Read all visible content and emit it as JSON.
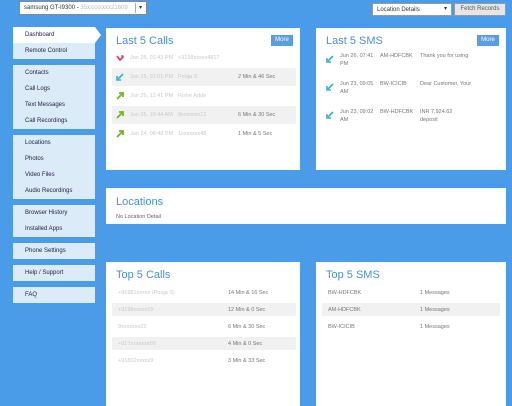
{
  "toolbar": {
    "device_label": "samsung GT-I9300 -",
    "device_id": "35xxxxxxxx21609",
    "location_select": "Location Details",
    "fetch_label": "Fetch Records"
  },
  "sidebar": {
    "groups": [
      [
        {
          "label": "Dashboard",
          "active": true
        },
        {
          "label": "Remote Control"
        }
      ],
      [
        {
          "label": "Contacts"
        },
        {
          "label": "Call Logs"
        },
        {
          "label": "Text Messages"
        },
        {
          "label": "Call Recordings"
        }
      ],
      [
        {
          "label": "Locations"
        },
        {
          "label": "Photos"
        },
        {
          "label": "Video Files"
        },
        {
          "label": "Audio Recordings"
        }
      ],
      [
        {
          "label": "Browser History"
        },
        {
          "label": "Installed Apps"
        }
      ],
      [
        {
          "label": "Phone Settings"
        }
      ],
      [
        {
          "label": "Help / Support"
        }
      ],
      [
        {
          "label": "FAQ"
        }
      ]
    ]
  },
  "last_calls": {
    "title": "Last 5 Calls",
    "more": "More",
    "rows": [
      {
        "type": "missed",
        "time": "Jun 25, 03:43 PM",
        "who": "+9198xxxxx4817",
        "dur": ""
      },
      {
        "type": "incoming",
        "time": "Jun 25, 01:01 PM",
        "who": "Pooja S",
        "dur": "2 Min & 46 Sec"
      },
      {
        "type": "outgoing",
        "time": "Jun 25, 12:41 PM",
        "who": "Rishe Adde",
        "dur": ""
      },
      {
        "type": "outgoing",
        "time": "Jun 25, 10:44 AM",
        "who": "9xxxxxxx12",
        "dur": "6 Min & 30 Sec"
      },
      {
        "type": "outgoing",
        "time": "Jun 24, 08:48 PM",
        "who": "1xxxxxxx48",
        "dur": "1 Min & 5 Sec"
      }
    ]
  },
  "last_sms": {
    "title": "Last 5 SMS",
    "more": "More",
    "rows": [
      {
        "time1": "Jun 26, 07:41",
        "time2": "PM",
        "sender": "AM-HDFCBK",
        "text": "Thank you for using"
      },
      {
        "time1": "Jun 23, 09:05",
        "time2": "AM",
        "sender": "BW-ICICIB",
        "text": "Dear Customer, Your"
      },
      {
        "time1": "Jun 23, 09:02",
        "time2": "AM",
        "sender": "BW-HDFCBK",
        "text": "INR 7,924.62",
        "text2": "deposit"
      }
    ]
  },
  "locations": {
    "title": "Locations",
    "empty": "No Location Detail"
  },
  "top_calls": {
    "title": "Top 5 Calls",
    "rows": [
      {
        "who": "+91981xxxxx (Pooja S)",
        "dur": "14 Min & 16 Sec"
      },
      {
        "who": "+9198xxxxx15",
        "dur": "12 Min & 0 Sec"
      },
      {
        "who": "9xxxxxxx22",
        "dur": "6 Min & 30 Sec"
      },
      {
        "who": "+917xxxxxxx09",
        "dur": "4 Min & 0 Sec"
      },
      {
        "who": "+91802xxxxx9",
        "dur": "3 Min & 33 Sec"
      }
    ]
  },
  "top_sms": {
    "title": "Top 5 SMS",
    "rows": [
      {
        "sender": "BW-HDFCBK",
        "count": "1 Messages"
      },
      {
        "sender": "AM-HDFCBK",
        "count": "1 Messages"
      },
      {
        "sender": "BW-ICICIB",
        "count": "1 Messages"
      }
    ]
  },
  "colors": {
    "bg": "#4a9ce8",
    "accent": "#4a8fd8",
    "missed": "#e0325a",
    "incoming": "#3ab0d0",
    "outgoing": "#6ab820"
  }
}
